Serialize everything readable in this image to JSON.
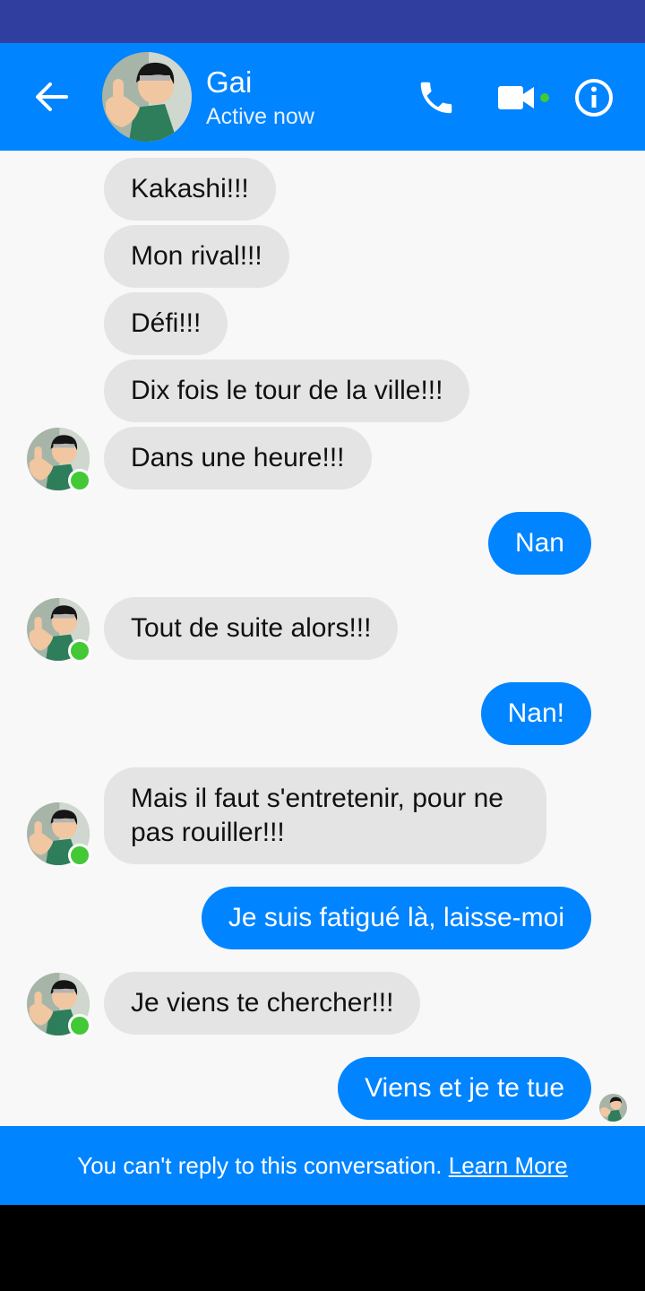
{
  "header": {
    "name": "Gai",
    "status": "Active now",
    "icons": [
      "back-arrow-icon",
      "phone-icon",
      "video-camera-icon",
      "info-icon"
    ],
    "accent": "#0084ff",
    "statusbar_color": "#303f9f",
    "online_color": "#42c935"
  },
  "messages": [
    {
      "from": "contact",
      "text": "Kakashi!!!"
    },
    {
      "from": "contact",
      "text": "Mon rival!!!"
    },
    {
      "from": "contact",
      "text": "Défi!!!"
    },
    {
      "from": "contact",
      "text": "Dix fois le tour de la ville!!!"
    },
    {
      "from": "contact",
      "text": "Dans une heure!!!"
    },
    {
      "from": "me",
      "text": "Nan"
    },
    {
      "from": "contact",
      "text": "Tout de suite alors!!!"
    },
    {
      "from": "me",
      "text": "Nan!"
    },
    {
      "from": "contact",
      "text": "Mais il faut s'entretenir, pour ne pas rouiller!!!"
    },
    {
      "from": "me",
      "text": "Je suis fatigué là, laisse-moi"
    },
    {
      "from": "contact",
      "text": "Je viens te chercher!!!"
    },
    {
      "from": "me",
      "text": "Viens et je te tue"
    }
  ],
  "footer": {
    "text": "You can't reply to this conversation.",
    "link": "Learn More"
  }
}
